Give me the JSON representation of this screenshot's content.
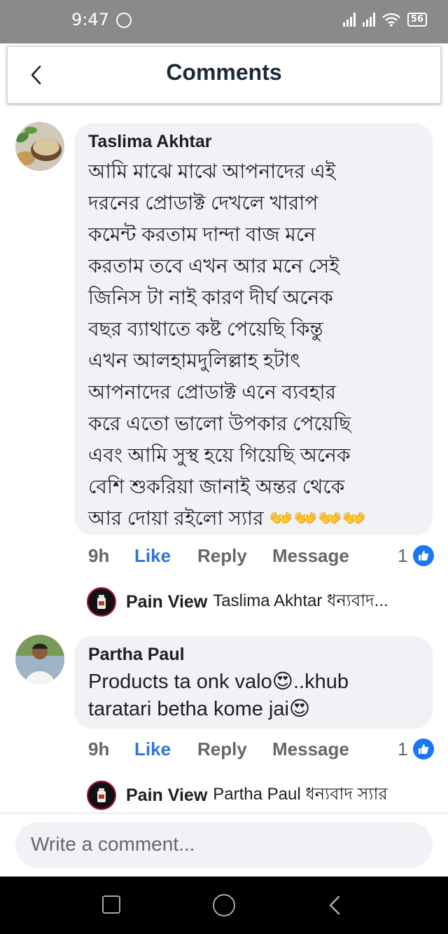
{
  "status_bar": {
    "time": "9:47",
    "battery": "56"
  },
  "header": {
    "title": "Comments"
  },
  "comments": [
    {
      "author": "Taslima Akhtar",
      "lines": [
        "আমি মাঝে মাঝে আপনাদের  এই",
        "দরনের  প্রোডাক্ট দেখলে খারাপ",
        "কমেন্ট  করতাম দান্দা বাজ মনে",
        "করতাম তবে এখন আর মনে সেই",
        "জিনিস টা নাই কারণ দীর্ঘ  অনেক",
        "বছর ব্যাথাতে কষ্ট পেয়েছি কিন্তু",
        "এখন আলহামদুলিল্লাহ হটাৎ",
        "আপনাদের  প্রোডাক্ট এনে ব্যবহার",
        "করে এতো ভালো উপকার পেয়েছি",
        "এবং আমি সুস্থ হয়ে গিয়েছি অনেক",
        "বেশি শুকরিয়া জানাই অন্তর থেকে",
        "আর দোয়া রইলো স্যার 👐👐👐👐"
      ],
      "time": "9h",
      "like_label": "Like",
      "reply_label": "Reply",
      "message_label": "Message",
      "like_count": "1",
      "reply": {
        "author": "Pain View",
        "text": "Taslima Akhtar ধন্যবাদ..."
      }
    },
    {
      "author": "Partha Paul",
      "lines": [
        "Products ta onk valo😍..khub",
        "taratari betha kome jai😍"
      ],
      "time": "9h",
      "like_label": "Like",
      "reply_label": "Reply",
      "message_label": "Message",
      "like_count": "1",
      "reply": {
        "author": "Pain View",
        "text": "Partha Paul ধন্যবাদ স্যার"
      }
    }
  ],
  "composer": {
    "placeholder": "Write a comment..."
  },
  "colors": {
    "accent": "#1877f2",
    "bubble": "#f0f2f5",
    "status_bar": "#8a8a8a"
  }
}
